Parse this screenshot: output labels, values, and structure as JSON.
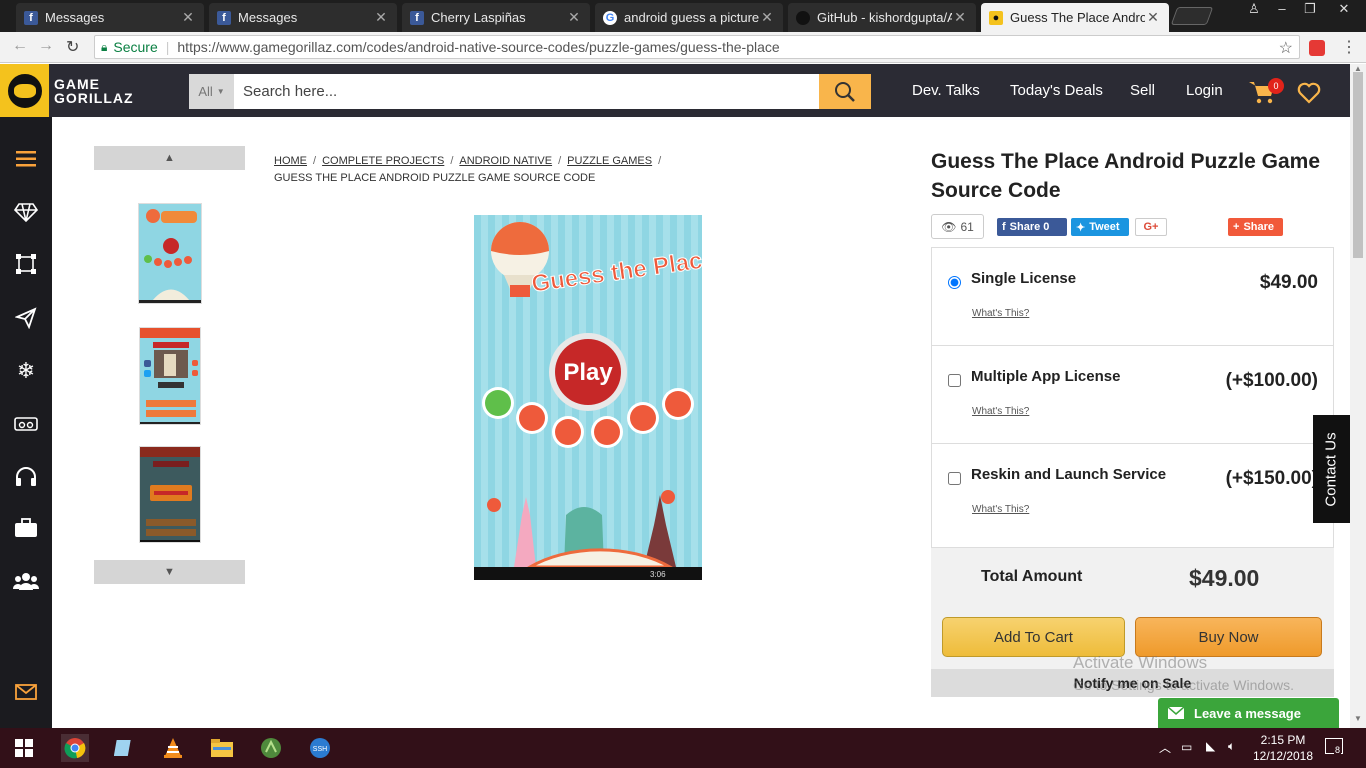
{
  "browser": {
    "tabs": [
      {
        "title": "Messages",
        "favicon": "facebook-icon",
        "active": false
      },
      {
        "title": "Messages",
        "favicon": "facebook-icon",
        "active": false
      },
      {
        "title": "Cherry Laspiñas",
        "favicon": "facebook-icon",
        "active": false
      },
      {
        "title": "android guess a picture s",
        "favicon": "google-icon",
        "active": false
      },
      {
        "title": "GitHub - kishordgupta/A",
        "favicon": "github-icon",
        "active": false
      },
      {
        "title": "Guess The Place Android",
        "favicon": "gamegorillaz-icon",
        "active": true
      }
    ],
    "secure_label": "Secure",
    "url": "https://www.gamegorillaz.com/codes/android-native-source-codes/puzzle-games/guess-the-place"
  },
  "header": {
    "logo_line1": "GAME",
    "logo_line2": "GORILLAZ",
    "search_category": "All",
    "search_placeholder": "Search here...",
    "nav": [
      "Dev. Talks",
      "Today's Deals",
      "Sell",
      "Login"
    ],
    "cart_count": "0",
    "accent_color": "#f9b54b"
  },
  "sidebar": {
    "icons": [
      "menu-icon",
      "diamond-icon",
      "crop-icon",
      "send-icon",
      "snowflake-icon",
      "vr-icon",
      "headphones-icon",
      "briefcase-icon",
      "users-icon",
      "mail-icon"
    ]
  },
  "breadcrumb": {
    "items": [
      "HOME",
      "COMPLETE PROJECTS",
      "ANDROID NATIVE",
      "PUZZLE GAMES"
    ],
    "current": "GUESS THE PLACE ANDROID PUZZLE GAME SOURCE CODE"
  },
  "product": {
    "title": "Guess The Place Android Puzzle Game Source Code",
    "views": "61",
    "share_fb": "Share 0",
    "tweet": "Tweet",
    "gplus": "G+",
    "share": "Share",
    "game_title": "Guess the Place",
    "play_label": "Play",
    "status_time": "3:06"
  },
  "licenses": [
    {
      "name": "Single License",
      "price": "$49.00",
      "whats": "What's This?",
      "selected": true,
      "control": "radio"
    },
    {
      "name": "Multiple App License",
      "price": "(+$100.00)",
      "whats": "What's This?",
      "selected": false,
      "control": "checkbox"
    },
    {
      "name": "Reskin and Launch Service",
      "price": "(+$150.00)",
      "whats": "What's This?",
      "selected": false,
      "control": "checkbox"
    }
  ],
  "total": {
    "label": "Total Amount",
    "price": "$49.00",
    "add_to_cart": "Add To Cart",
    "buy_now": "Buy Now",
    "notify": "Notify me on Sale"
  },
  "watermark": {
    "line1": "Activate Windows",
    "line2": "Go to Settings to activate Windows."
  },
  "widgets": {
    "contact_us": "Contact Us",
    "leave_message": "Leave a message"
  },
  "taskbar": {
    "time": "2:15 PM",
    "date": "12/12/2018",
    "notifications": "8",
    "apps": [
      "chrome-icon",
      "notepad-icon",
      "vlc-icon",
      "file-explorer-icon",
      "android-studio-icon",
      "ssh-icon"
    ]
  }
}
